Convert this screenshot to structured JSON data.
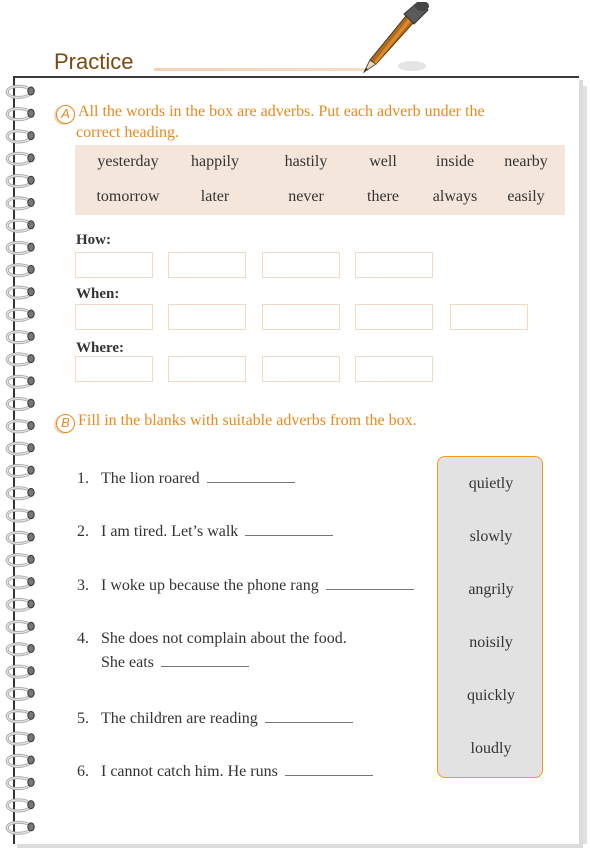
{
  "header": {
    "title": "Practice"
  },
  "section_a": {
    "badge": "A",
    "instruction": "All the words in the box are adverbs. Put each adverb under the correct heading.",
    "instruction_line1": "All the words in the box are adverbs. Put each adverb under the",
    "instruction_line2": "correct heading.",
    "word_box": {
      "rows": [
        [
          "yesterday",
          "happily",
          "hastily",
          "well",
          "inside",
          "nearby"
        ],
        [
          "tomorrow",
          "later",
          "never",
          "there",
          "always",
          "easily"
        ]
      ]
    },
    "categories": [
      {
        "label": "How:",
        "boxes": [
          "",
          "",
          "",
          ""
        ]
      },
      {
        "label": "When:",
        "boxes": [
          "",
          "",
          "",
          "",
          ""
        ]
      },
      {
        "label": "Where:",
        "boxes": [
          "",
          "",
          "",
          ""
        ]
      }
    ]
  },
  "section_b": {
    "badge": "B",
    "instruction": "Fill in the blanks with suitable adverbs from the box.",
    "questions": [
      {
        "num": "1.",
        "text": "The lion roared",
        "answer": ""
      },
      {
        "num": "2.",
        "text": "I am tired. Let’s walk",
        "answer": ""
      },
      {
        "num": "3.",
        "text": "I woke up because the phone rang",
        "answer": ""
      },
      {
        "num": "4.",
        "text": "She does not complain about the food.",
        "text2": "She eats",
        "answer": ""
      },
      {
        "num": "5.",
        "text": "The children are reading",
        "answer": ""
      },
      {
        "num": "6.",
        "text": "I cannot catch him. He runs",
        "answer": ""
      }
    ],
    "options": [
      "quietly",
      "slowly",
      "angrily",
      "noisily",
      "quickly",
      "loudly"
    ]
  },
  "colors": {
    "accent": "#e68a1e",
    "panel_border": "#f29a1f",
    "word_box_bg": "#f5e6dc",
    "answer_box_border": "#f2d9c6",
    "title": "#7a4a10"
  }
}
